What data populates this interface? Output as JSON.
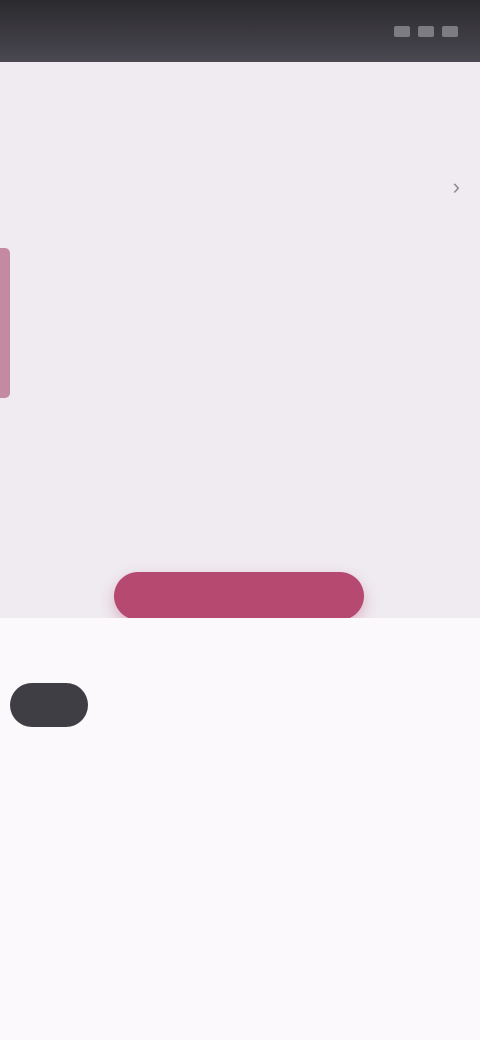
{
  "status_bar": {
    "time": "",
    "icons": [
      "signal-icon",
      "wifi-icon",
      "battery-icon"
    ]
  },
  "appbar": {
    "title": "",
    "action": ""
  },
  "section": {
    "label": ""
  },
  "event_card": {
    "title": "",
    "subtitle_1": "",
    "subtitle_2": ""
  },
  "primary_button": {
    "label": ""
  },
  "picker": {
    "weekdays": [
      "",
      "",
      "",
      "",
      "",
      ""
    ],
    "rows": [
      [
        "",
        "",
        "",
        "",
        "",
        ""
      ],
      [
        "",
        "",
        "",
        "",
        "",
        ""
      ],
      [
        "",
        "",
        "",
        "",
        "",
        ""
      ],
      [
        "",
        "",
        "",
        "",
        "",
        ""
      ],
      [
        "",
        "",
        "",
        "",
        "",
        ""
      ]
    ],
    "selected": {
      "row": 0,
      "col": 0
    }
  },
  "colors": {
    "accent": "#b5496f",
    "selected_bg": "#3f3e44",
    "background": "#efebf0"
  }
}
